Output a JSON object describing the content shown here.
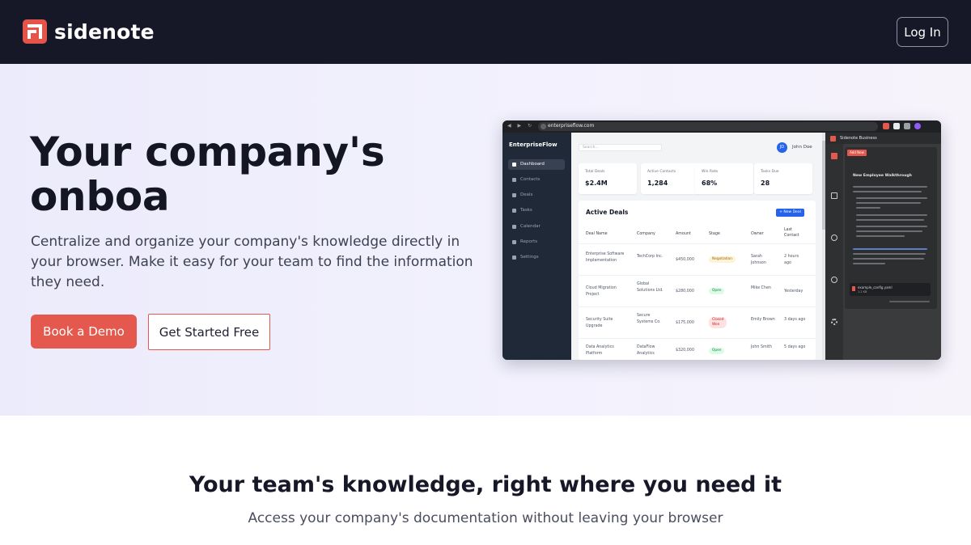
{
  "nav": {
    "brand": "sidenote",
    "login_label": "Log In"
  },
  "hero": {
    "title": "Your company's onboa",
    "subtitle": "Centralize and organize your company's knowledge directly in your browser. Make it easy for your team to find the information they need.",
    "primary_cta": "Book a Demo",
    "secondary_cta": "Get Started Free"
  },
  "mockup": {
    "url": "enterpriseflow.com",
    "app_brand": "EnterpriseFlow",
    "search_placeholder": "Search...",
    "user_initials": "JD",
    "user_name": "John Doe",
    "sidebar": [
      "Dashboard",
      "Contacts",
      "Deals",
      "Tasks",
      "Calendar",
      "Reports",
      "Settings"
    ],
    "stats": [
      {
        "label": "Total Deals",
        "value": "$2.4M"
      },
      {
        "label": "Active Contacts",
        "value": "1,284"
      },
      {
        "label": "Win Rate",
        "value": "68%"
      },
      {
        "label": "Tasks Due",
        "value": "28"
      }
    ],
    "deals_title": "Active Deals",
    "new_deal_label": "+ New Deal",
    "columns": [
      "Deal Name",
      "Company",
      "Amount",
      "Stage",
      "Owner",
      "Last Contact"
    ],
    "rows": [
      {
        "name": "Enterprise Software Implementation",
        "company": "TechCorp Inc.",
        "amount": "$450,000",
        "stage": "Negotiation",
        "owner": "Sarah Johnson",
        "last": "2 hours ago"
      },
      {
        "name": "Cloud Migration Project",
        "company": "Global Solutions Ltd.",
        "amount": "$280,000",
        "stage": "Open",
        "owner": "Mike Chen",
        "last": "Yesterday"
      },
      {
        "name": "Security Suite Upgrade",
        "company": "Secure Systems Co.",
        "amount": "$175,000",
        "stage": "Closed Won",
        "owner": "Emily Brown",
        "last": "3 days ago"
      },
      {
        "name": "Data Analytics Platform",
        "company": "DataFlow Analytics",
        "amount": "$320,000",
        "stage": "Open",
        "owner": "John Smith",
        "last": "5 days ago"
      }
    ],
    "panel_title": "Sidenote Business",
    "panel_add_label": "Add New",
    "panel_heading": "New Employee Walkthrough",
    "panel_file_name": "example_config.yaml",
    "panel_file_size": "1.2 KB"
  },
  "features": {
    "title": "Your team's knowledge, right where you need it",
    "subtitle": "Access your company's documentation without leaving your browser"
  },
  "colors": {
    "nav_bg": "#161727",
    "accent": "#e4584d",
    "hero_bg": "#ecebfb"
  }
}
